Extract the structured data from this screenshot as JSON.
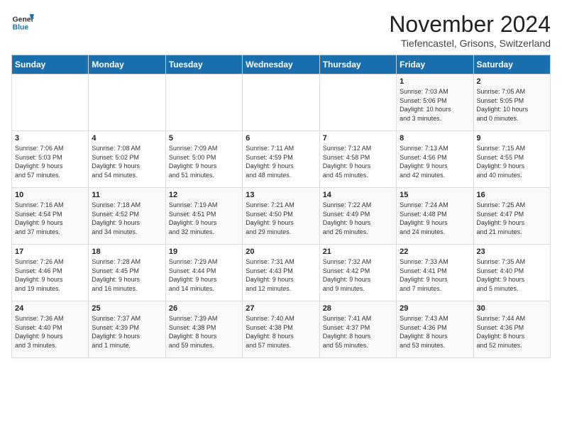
{
  "logo": {
    "line1": "General",
    "line2": "Blue"
  },
  "title": "November 2024",
  "location": "Tiefencastel, Grisons, Switzerland",
  "days_of_week": [
    "Sunday",
    "Monday",
    "Tuesday",
    "Wednesday",
    "Thursday",
    "Friday",
    "Saturday"
  ],
  "weeks": [
    [
      {
        "day": "",
        "info": ""
      },
      {
        "day": "",
        "info": ""
      },
      {
        "day": "",
        "info": ""
      },
      {
        "day": "",
        "info": ""
      },
      {
        "day": "",
        "info": ""
      },
      {
        "day": "1",
        "info": "Sunrise: 7:03 AM\nSunset: 5:06 PM\nDaylight: 10 hours\nand 3 minutes."
      },
      {
        "day": "2",
        "info": "Sunrise: 7:05 AM\nSunset: 5:05 PM\nDaylight: 10 hours\nand 0 minutes."
      }
    ],
    [
      {
        "day": "3",
        "info": "Sunrise: 7:06 AM\nSunset: 5:03 PM\nDaylight: 9 hours\nand 57 minutes."
      },
      {
        "day": "4",
        "info": "Sunrise: 7:08 AM\nSunset: 5:02 PM\nDaylight: 9 hours\nand 54 minutes."
      },
      {
        "day": "5",
        "info": "Sunrise: 7:09 AM\nSunset: 5:00 PM\nDaylight: 9 hours\nand 51 minutes."
      },
      {
        "day": "6",
        "info": "Sunrise: 7:11 AM\nSunset: 4:59 PM\nDaylight: 9 hours\nand 48 minutes."
      },
      {
        "day": "7",
        "info": "Sunrise: 7:12 AM\nSunset: 4:58 PM\nDaylight: 9 hours\nand 45 minutes."
      },
      {
        "day": "8",
        "info": "Sunrise: 7:13 AM\nSunset: 4:56 PM\nDaylight: 9 hours\nand 42 minutes."
      },
      {
        "day": "9",
        "info": "Sunrise: 7:15 AM\nSunset: 4:55 PM\nDaylight: 9 hours\nand 40 minutes."
      }
    ],
    [
      {
        "day": "10",
        "info": "Sunrise: 7:16 AM\nSunset: 4:54 PM\nDaylight: 9 hours\nand 37 minutes."
      },
      {
        "day": "11",
        "info": "Sunrise: 7:18 AM\nSunset: 4:52 PM\nDaylight: 9 hours\nand 34 minutes."
      },
      {
        "day": "12",
        "info": "Sunrise: 7:19 AM\nSunset: 4:51 PM\nDaylight: 9 hours\nand 32 minutes."
      },
      {
        "day": "13",
        "info": "Sunrise: 7:21 AM\nSunset: 4:50 PM\nDaylight: 9 hours\nand 29 minutes."
      },
      {
        "day": "14",
        "info": "Sunrise: 7:22 AM\nSunset: 4:49 PM\nDaylight: 9 hours\nand 26 minutes."
      },
      {
        "day": "15",
        "info": "Sunrise: 7:24 AM\nSunset: 4:48 PM\nDaylight: 9 hours\nand 24 minutes."
      },
      {
        "day": "16",
        "info": "Sunrise: 7:25 AM\nSunset: 4:47 PM\nDaylight: 9 hours\nand 21 minutes."
      }
    ],
    [
      {
        "day": "17",
        "info": "Sunrise: 7:26 AM\nSunset: 4:46 PM\nDaylight: 9 hours\nand 19 minutes."
      },
      {
        "day": "18",
        "info": "Sunrise: 7:28 AM\nSunset: 4:45 PM\nDaylight: 9 hours\nand 16 minutes."
      },
      {
        "day": "19",
        "info": "Sunrise: 7:29 AM\nSunset: 4:44 PM\nDaylight: 9 hours\nand 14 minutes."
      },
      {
        "day": "20",
        "info": "Sunrise: 7:31 AM\nSunset: 4:43 PM\nDaylight: 9 hours\nand 12 minutes."
      },
      {
        "day": "21",
        "info": "Sunrise: 7:32 AM\nSunset: 4:42 PM\nDaylight: 9 hours\nand 9 minutes."
      },
      {
        "day": "22",
        "info": "Sunrise: 7:33 AM\nSunset: 4:41 PM\nDaylight: 9 hours\nand 7 minutes."
      },
      {
        "day": "23",
        "info": "Sunrise: 7:35 AM\nSunset: 4:40 PM\nDaylight: 9 hours\nand 5 minutes."
      }
    ],
    [
      {
        "day": "24",
        "info": "Sunrise: 7:36 AM\nSunset: 4:40 PM\nDaylight: 9 hours\nand 3 minutes."
      },
      {
        "day": "25",
        "info": "Sunrise: 7:37 AM\nSunset: 4:39 PM\nDaylight: 9 hours\nand 1 minute."
      },
      {
        "day": "26",
        "info": "Sunrise: 7:39 AM\nSunset: 4:38 PM\nDaylight: 8 hours\nand 59 minutes."
      },
      {
        "day": "27",
        "info": "Sunrise: 7:40 AM\nSunset: 4:38 PM\nDaylight: 8 hours\nand 57 minutes."
      },
      {
        "day": "28",
        "info": "Sunrise: 7:41 AM\nSunset: 4:37 PM\nDaylight: 8 hours\nand 55 minutes."
      },
      {
        "day": "29",
        "info": "Sunrise: 7:43 AM\nSunset: 4:36 PM\nDaylight: 8 hours\nand 53 minutes."
      },
      {
        "day": "30",
        "info": "Sunrise: 7:44 AM\nSunset: 4:36 PM\nDaylight: 8 hours\nand 52 minutes."
      }
    ]
  ]
}
